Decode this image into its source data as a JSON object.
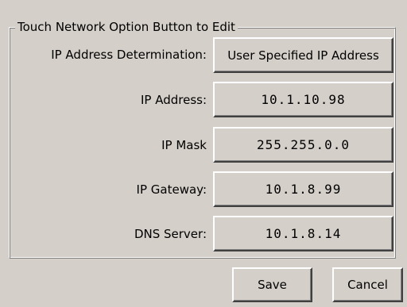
{
  "group": {
    "title": "Touch Network Option Button to Edit"
  },
  "rows": [
    {
      "label": "IP Address Determination:",
      "value": "User Specified IP Address"
    },
    {
      "label": "IP Address:",
      "value": "10.1.10.98"
    },
    {
      "label": "IP Mask",
      "value": "255.255.0.0"
    },
    {
      "label": "IP Gateway:",
      "value": "10.1.8.99"
    },
    {
      "label": "DNS Server:",
      "value": "10.1.8.14"
    }
  ],
  "actions": {
    "save_label": "Save",
    "cancel_label": "Cancel"
  }
}
